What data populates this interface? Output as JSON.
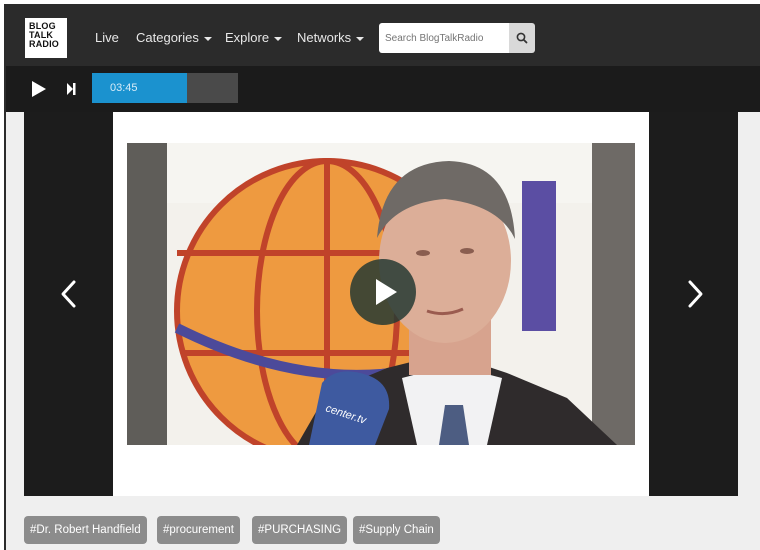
{
  "logo": {
    "lines": [
      "BLOG",
      "TALK",
      "RADIO"
    ]
  },
  "nav": {
    "items": [
      {
        "label": "Live",
        "has_caret": false
      },
      {
        "label": "Categories",
        "has_caret": true
      },
      {
        "label": "Explore",
        "has_caret": true
      },
      {
        "label": "Networks",
        "has_caret": true
      }
    ],
    "search_placeholder": "Search BlogTalkRadio",
    "search_icon": "search-icon"
  },
  "player": {
    "time": "03:45",
    "progress": 0.65,
    "play_icon": "play-icon",
    "skip_icon": "skip-forward-icon"
  },
  "carousel": {
    "prev_icon": "chevron-left-icon",
    "next_icon": "chevron-right-icon",
    "video_play_icon": "play-icon",
    "mic_text": "center.tv"
  },
  "tags": [
    "#Dr. Robert Handfield",
    "#procurement",
    "#PURCHASING",
    "#Supply Chain"
  ],
  "colors": {
    "accent": "#1b92cf",
    "nav_bg": "#2b2b2b",
    "player_bg": "#1b1b1b",
    "tag_bg": "#8c8c8c"
  }
}
